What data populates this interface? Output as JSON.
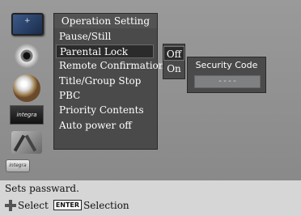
{
  "menu": {
    "title": "Operation Setting",
    "items": [
      {
        "label": "Pause/Still"
      },
      {
        "label": "Parental Lock"
      },
      {
        "label": "Remote Confirmation"
      },
      {
        "label": "Title/Group Stop"
      },
      {
        "label": "PBC"
      },
      {
        "label": "Priority Contents"
      },
      {
        "label": "Auto power off"
      }
    ]
  },
  "submenu": {
    "options": [
      {
        "label": "Off",
        "selected": true
      },
      {
        "label": "On",
        "selected": false
      }
    ]
  },
  "security": {
    "title": "Security Code",
    "value": "----"
  },
  "icons": {
    "integra_label": "integra",
    "bottom_logo": "integra"
  },
  "status": {
    "message": "Sets passward.",
    "select_label": "Select",
    "enter_key": "ENTER",
    "selection_label": "Selection"
  }
}
